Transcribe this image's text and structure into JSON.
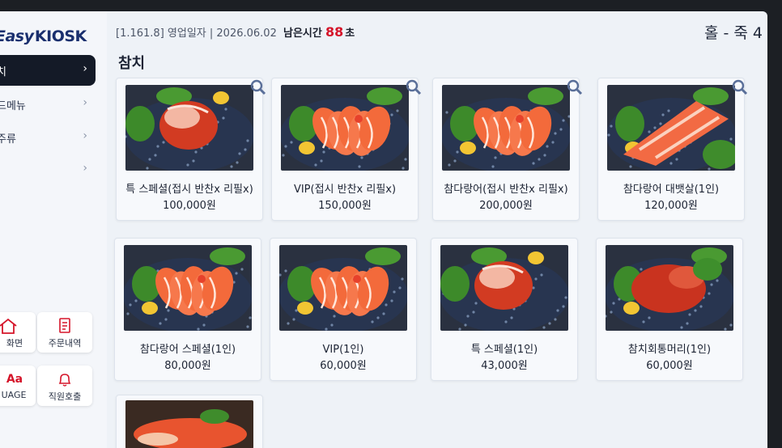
{
  "app": {
    "logo_prefix": "Easy",
    "logo_main": "KIOSK",
    "version": "[1.161.8]",
    "business_day_label": "영업일자",
    "business_day": "2026.06.02",
    "remaining_label": "남은시간",
    "remaining_value": "88",
    "remaining_unit": "초",
    "table_label": "홀 - 죽 4",
    "accent_color": "#d5152a",
    "sidebar_active_color": "#141a27"
  },
  "sidebar": {
    "categories": [
      {
        "label": "치",
        "active": true,
        "icon": "chevron-right-icon"
      },
      {
        "label": "드메뉴",
        "active": false,
        "icon": "chevron-right-icon"
      },
      {
        "label": "주류",
        "active": false,
        "icon": "chevron-right-icon"
      },
      {
        "label": "",
        "active": false,
        "icon": "chevron-right-icon"
      }
    ],
    "buttons": [
      {
        "label": "화면",
        "icon": "home-icon"
      },
      {
        "label": "주문내역",
        "icon": "receipt-icon"
      },
      {
        "label": "UAGE",
        "icon": "language-icon"
      },
      {
        "label": "직원호출",
        "icon": "bell-icon"
      }
    ]
  },
  "section": {
    "title": "참치"
  },
  "products": [
    {
      "name": "특 스페셜(접시 반찬x 리필x)",
      "price": "100,000원",
      "image": "tuna-platter-photo"
    },
    {
      "name": "VIP(접시 반찬x 리필x)",
      "price": "150,000원",
      "image": "salmon-platter-photo"
    },
    {
      "name": "참다랑어(접시 반찬x 리필x)",
      "price": "200,000원",
      "image": "salmon-platter-photo"
    },
    {
      "name": "참다랑어 대뱃살(1인)",
      "price": "120,000원",
      "image": "salmon-belly-photo"
    },
    {
      "name": "참다랑어 스페셜(1인)",
      "price": "80,000원",
      "image": "salmon-platter-photo"
    },
    {
      "name": "VIP(1인)",
      "price": "60,000원",
      "image": "salmon-platter-photo"
    },
    {
      "name": "특 스페셜(1인)",
      "price": "43,000원",
      "image": "tuna-platter-photo"
    },
    {
      "name": "참치회통머리(1인)",
      "price": "60,000원",
      "image": "tuna-head-photo"
    }
  ]
}
